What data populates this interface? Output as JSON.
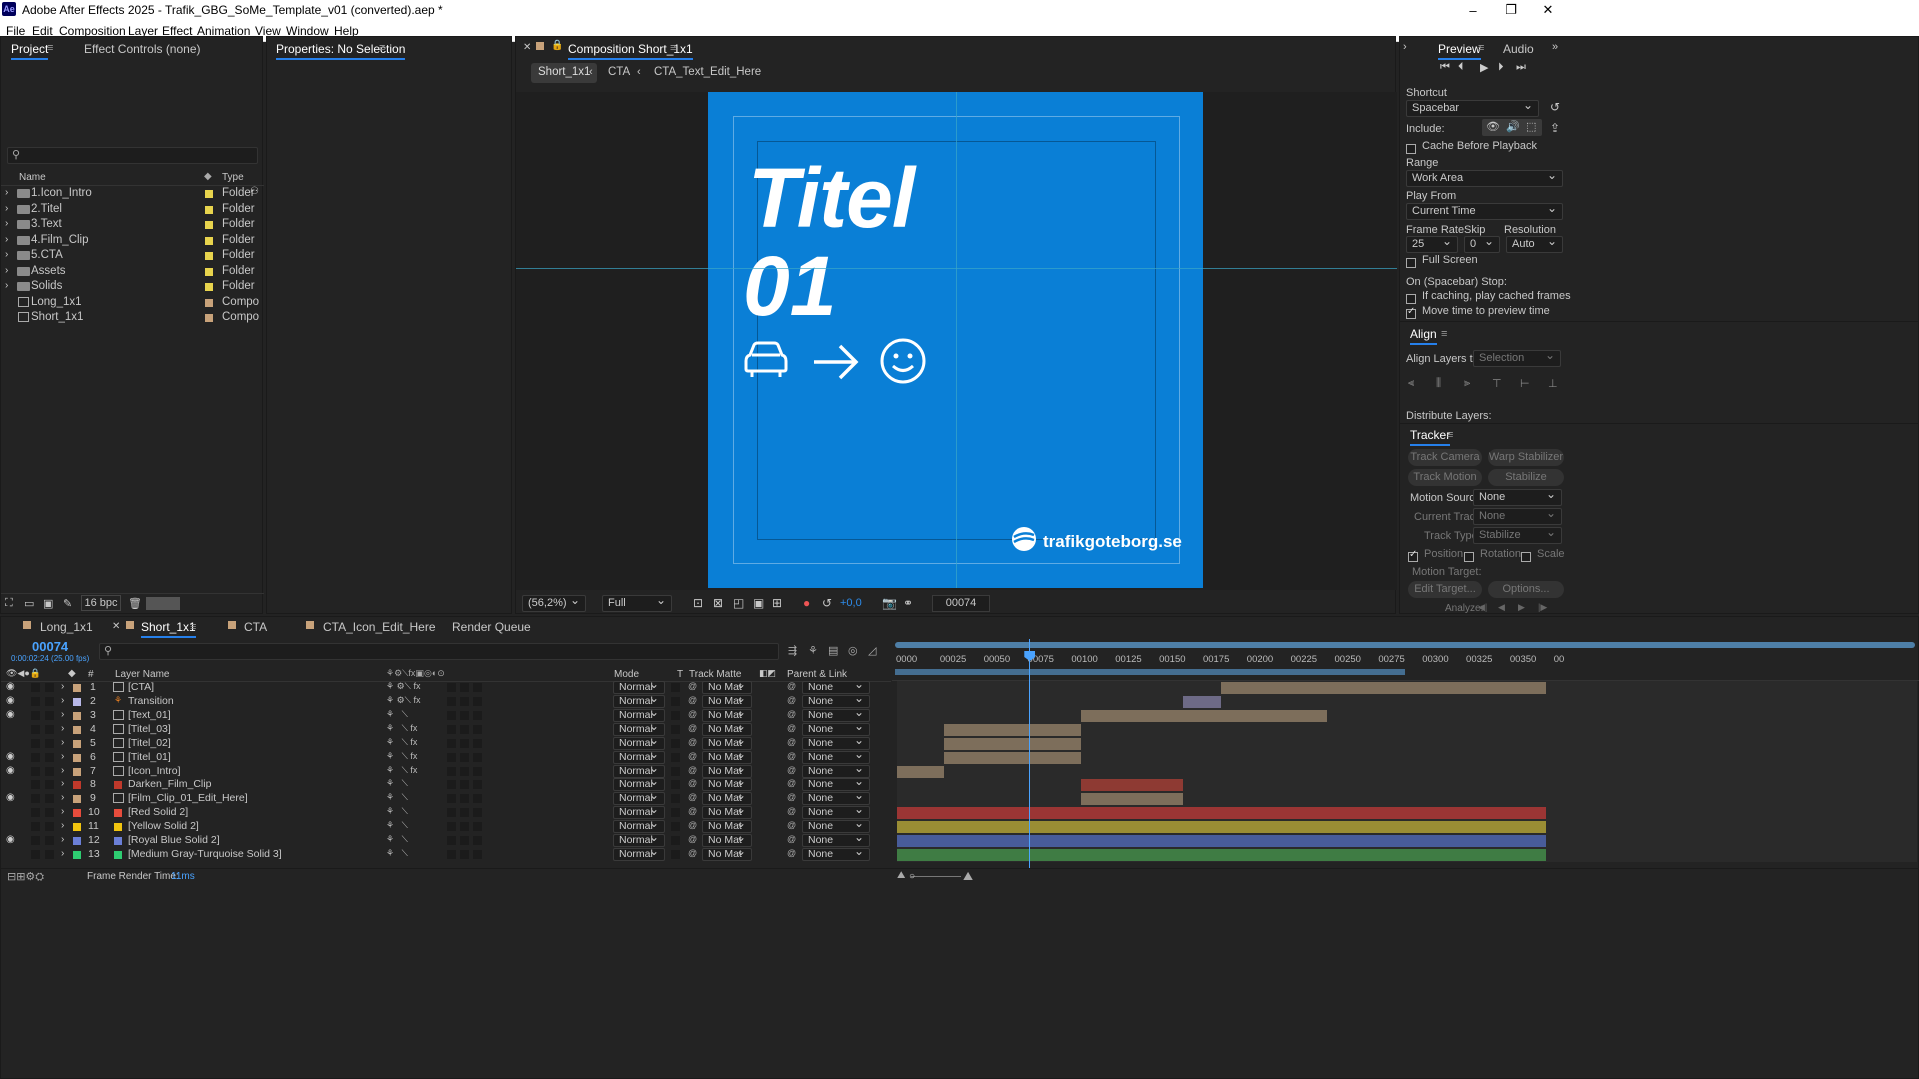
{
  "window": {
    "title": "Adobe After Effects 2025 - Trafik_GBG_SoMe_Template_v01 (converted).aep *",
    "app_icon": "Ae",
    "minimize": "–",
    "maximize": "❐",
    "close": "✕"
  },
  "menu": [
    "File",
    "Edit",
    "Composition",
    "Layer",
    "Effect",
    "Animation",
    "View",
    "Window",
    "Help"
  ],
  "project_panel": {
    "tab_project": "Project",
    "tab_effect_controls": "Effect Controls (none)",
    "search_placeholder": "",
    "col_name": "Name",
    "col_type": "Type",
    "items": [
      {
        "name": "1.Icon_Intro",
        "type": "Folder",
        "kind": "folder"
      },
      {
        "name": "2.Titel",
        "type": "Folder",
        "kind": "folder"
      },
      {
        "name": "3.Text",
        "type": "Folder",
        "kind": "folder"
      },
      {
        "name": "4.Film_Clip",
        "type": "Folder",
        "kind": "folder"
      },
      {
        "name": "5.CTA",
        "type": "Folder",
        "kind": "folder"
      },
      {
        "name": "Assets",
        "type": "Folder",
        "kind": "folder"
      },
      {
        "name": "Solids",
        "type": "Folder",
        "kind": "folder"
      },
      {
        "name": "Long_1x1",
        "type": "Compo",
        "kind": "comp"
      },
      {
        "name": "Short_1x1",
        "type": "Compo",
        "kind": "comp"
      }
    ],
    "bpc": "16 bpc"
  },
  "properties_panel": {
    "title": "Properties: No Selection"
  },
  "comp_panel": {
    "title": "Composition Short_1x1",
    "breadcrumbs": [
      "Short_1x1",
      "CTA",
      "CTA_Text_Edit_Here"
    ],
    "canvas_title": "Titel",
    "canvas_number": "01",
    "logo_text": "trafikgoteborg.se",
    "canvas_color": "#0a7fd6",
    "zoom": "(56,2%)",
    "resolution": "Full",
    "exposure": "+0,0",
    "timecode": "00074"
  },
  "preview_panel": {
    "tab_preview": "Preview",
    "tab_audio": "Audio",
    "shortcut_label": "Shortcut",
    "shortcut_value": "Spacebar",
    "include_label": "Include:",
    "cache_before_playback": "Cache Before Playback",
    "range_label": "Range",
    "range_value": "Work Area",
    "play_from_label": "Play From",
    "play_from_value": "Current Time",
    "frame_rate_label": "Frame Rate",
    "frame_rate_value": "25",
    "skip_label": "Skip",
    "skip_value": "0",
    "resolution_label": "Resolution",
    "resolution_value": "Auto",
    "full_screen": "Full Screen",
    "on_stop_label": "On (Spacebar) Stop:",
    "if_caching": "If caching, play cached frames",
    "move_time": "Move time to preview time"
  },
  "align_panel": {
    "title": "Align",
    "align_layers_to": "Align Layers to:",
    "align_value": "Selection",
    "distribute": "Distribute Layers:"
  },
  "tracker_panel": {
    "title": "Tracker",
    "track_camera": "Track Camera",
    "warp_stabilizer": "Warp Stabilizer",
    "track_motion": "Track Motion",
    "stabilize_motion": "Stabilize Motion",
    "motion_source_label": "Motion Source:",
    "motion_source_value": "None",
    "current_track_label": "Current Track:",
    "current_track_value": "None",
    "track_type_label": "Track Type:",
    "track_type_value": "Stabilize",
    "position": "Position",
    "rotation": "Rotation",
    "scale": "Scale",
    "motion_target": "Motion Target:",
    "edit_target": "Edit Target...",
    "options": "Options...",
    "analyze": "Analyze:"
  },
  "timeline": {
    "tabs": [
      "Long_1x1",
      "Short_1x1",
      "CTA",
      "CTA_Icon_Edit_Here",
      "Render Queue"
    ],
    "current_time": "00074",
    "current_time_sub": "0:00:02:24 (25.00 fps)",
    "col_num": "#",
    "col_layer_name": "Layer Name",
    "col_mode": "Mode",
    "col_t": "T",
    "col_track_matte": "Track Matte",
    "col_parent": "Parent & Link",
    "ruler": [
      "0000",
      "00025",
      "00050",
      "00075",
      "00100",
      "00125",
      "00150",
      "00175",
      "00200",
      "00225",
      "00250",
      "00275",
      "00300",
      "00325",
      "00350",
      "00"
    ],
    "playhead_frame": 74,
    "layers": [
      {
        "num": "1",
        "name": "[CTA]",
        "label": "#c8a27a",
        "icon": "comp",
        "fx": true,
        "eye": true,
        "start": 185,
        "end": 370,
        "clip": "#7d6e5b"
      },
      {
        "num": "2",
        "name": "Transition",
        "label": "#b8b8e8",
        "icon": "adj",
        "fx": true,
        "eye": true,
        "start": 163,
        "end": 185,
        "clip": "#6d6a86"
      },
      {
        "num": "3",
        "name": "[Text_01]",
        "label": "#c8a27a",
        "icon": "comp",
        "fx": false,
        "eye": true,
        "start": 105,
        "end": 245,
        "clip": "#7d6e5b"
      },
      {
        "num": "4",
        "name": "[Titel_03]",
        "label": "#c8a27a",
        "icon": "comp",
        "fx": true,
        "eye": false,
        "start": 27,
        "end": 105,
        "clip": "#7d6e5b"
      },
      {
        "num": "5",
        "name": "[Titel_02]",
        "label": "#c8a27a",
        "icon": "comp",
        "fx": true,
        "eye": false,
        "start": 27,
        "end": 105,
        "clip": "#7d6e5b"
      },
      {
        "num": "6",
        "name": "[Titel_01]",
        "label": "#c8a27a",
        "icon": "comp",
        "fx": true,
        "eye": true,
        "start": 27,
        "end": 105,
        "clip": "#7d6e5b"
      },
      {
        "num": "7",
        "name": "[Icon_Intro]",
        "label": "#c8a27a",
        "icon": "comp",
        "fx": true,
        "eye": true,
        "start": 0,
        "end": 27,
        "clip": "#7d6e5b"
      },
      {
        "num": "8",
        "name": "Darken_Film_Clip",
        "label": "#c0392b",
        "icon": "solid",
        "fx": false,
        "eye": false,
        "start": 105,
        "end": 163,
        "clip": "#8e3a33"
      },
      {
        "num": "9",
        "name": "[Film_Clip_01_Edit_Here]",
        "label": "#c8a27a",
        "icon": "comp",
        "fx": false,
        "eye": true,
        "start": 105,
        "end": 163,
        "clip": "#7d6e5b"
      },
      {
        "num": "10",
        "name": "[Red Solid 2]",
        "label": "#e74c3c",
        "icon": "solid-red",
        "fx": false,
        "eye": false,
        "start": 0,
        "end": 370,
        "clip": "#9b3534"
      },
      {
        "num": "11",
        "name": "[Yellow Solid 2]",
        "label": "#f1c40f",
        "icon": "solid-yellow",
        "fx": false,
        "eye": false,
        "start": 0,
        "end": 370,
        "clip": "#9a8d34"
      },
      {
        "num": "12",
        "name": "[Royal Blue Solid 2]",
        "label": "#6b7fd7",
        "icon": "solid-blue",
        "fx": false,
        "eye": true,
        "start": 0,
        "end": 370,
        "clip": "#485c9a"
      },
      {
        "num": "13",
        "name": "[Medium Gray-Turquoise Solid 3]",
        "label": "#2ecc71",
        "icon": "solid-green",
        "fx": false,
        "eye": false,
        "start": 0,
        "end": 370,
        "clip": "#3f7c44"
      }
    ],
    "mode_value": "Normal",
    "matte_value": "No Mat",
    "parent_value": "None",
    "frame_render_label": "Frame Render Time:",
    "frame_render_value": "11ms"
  }
}
